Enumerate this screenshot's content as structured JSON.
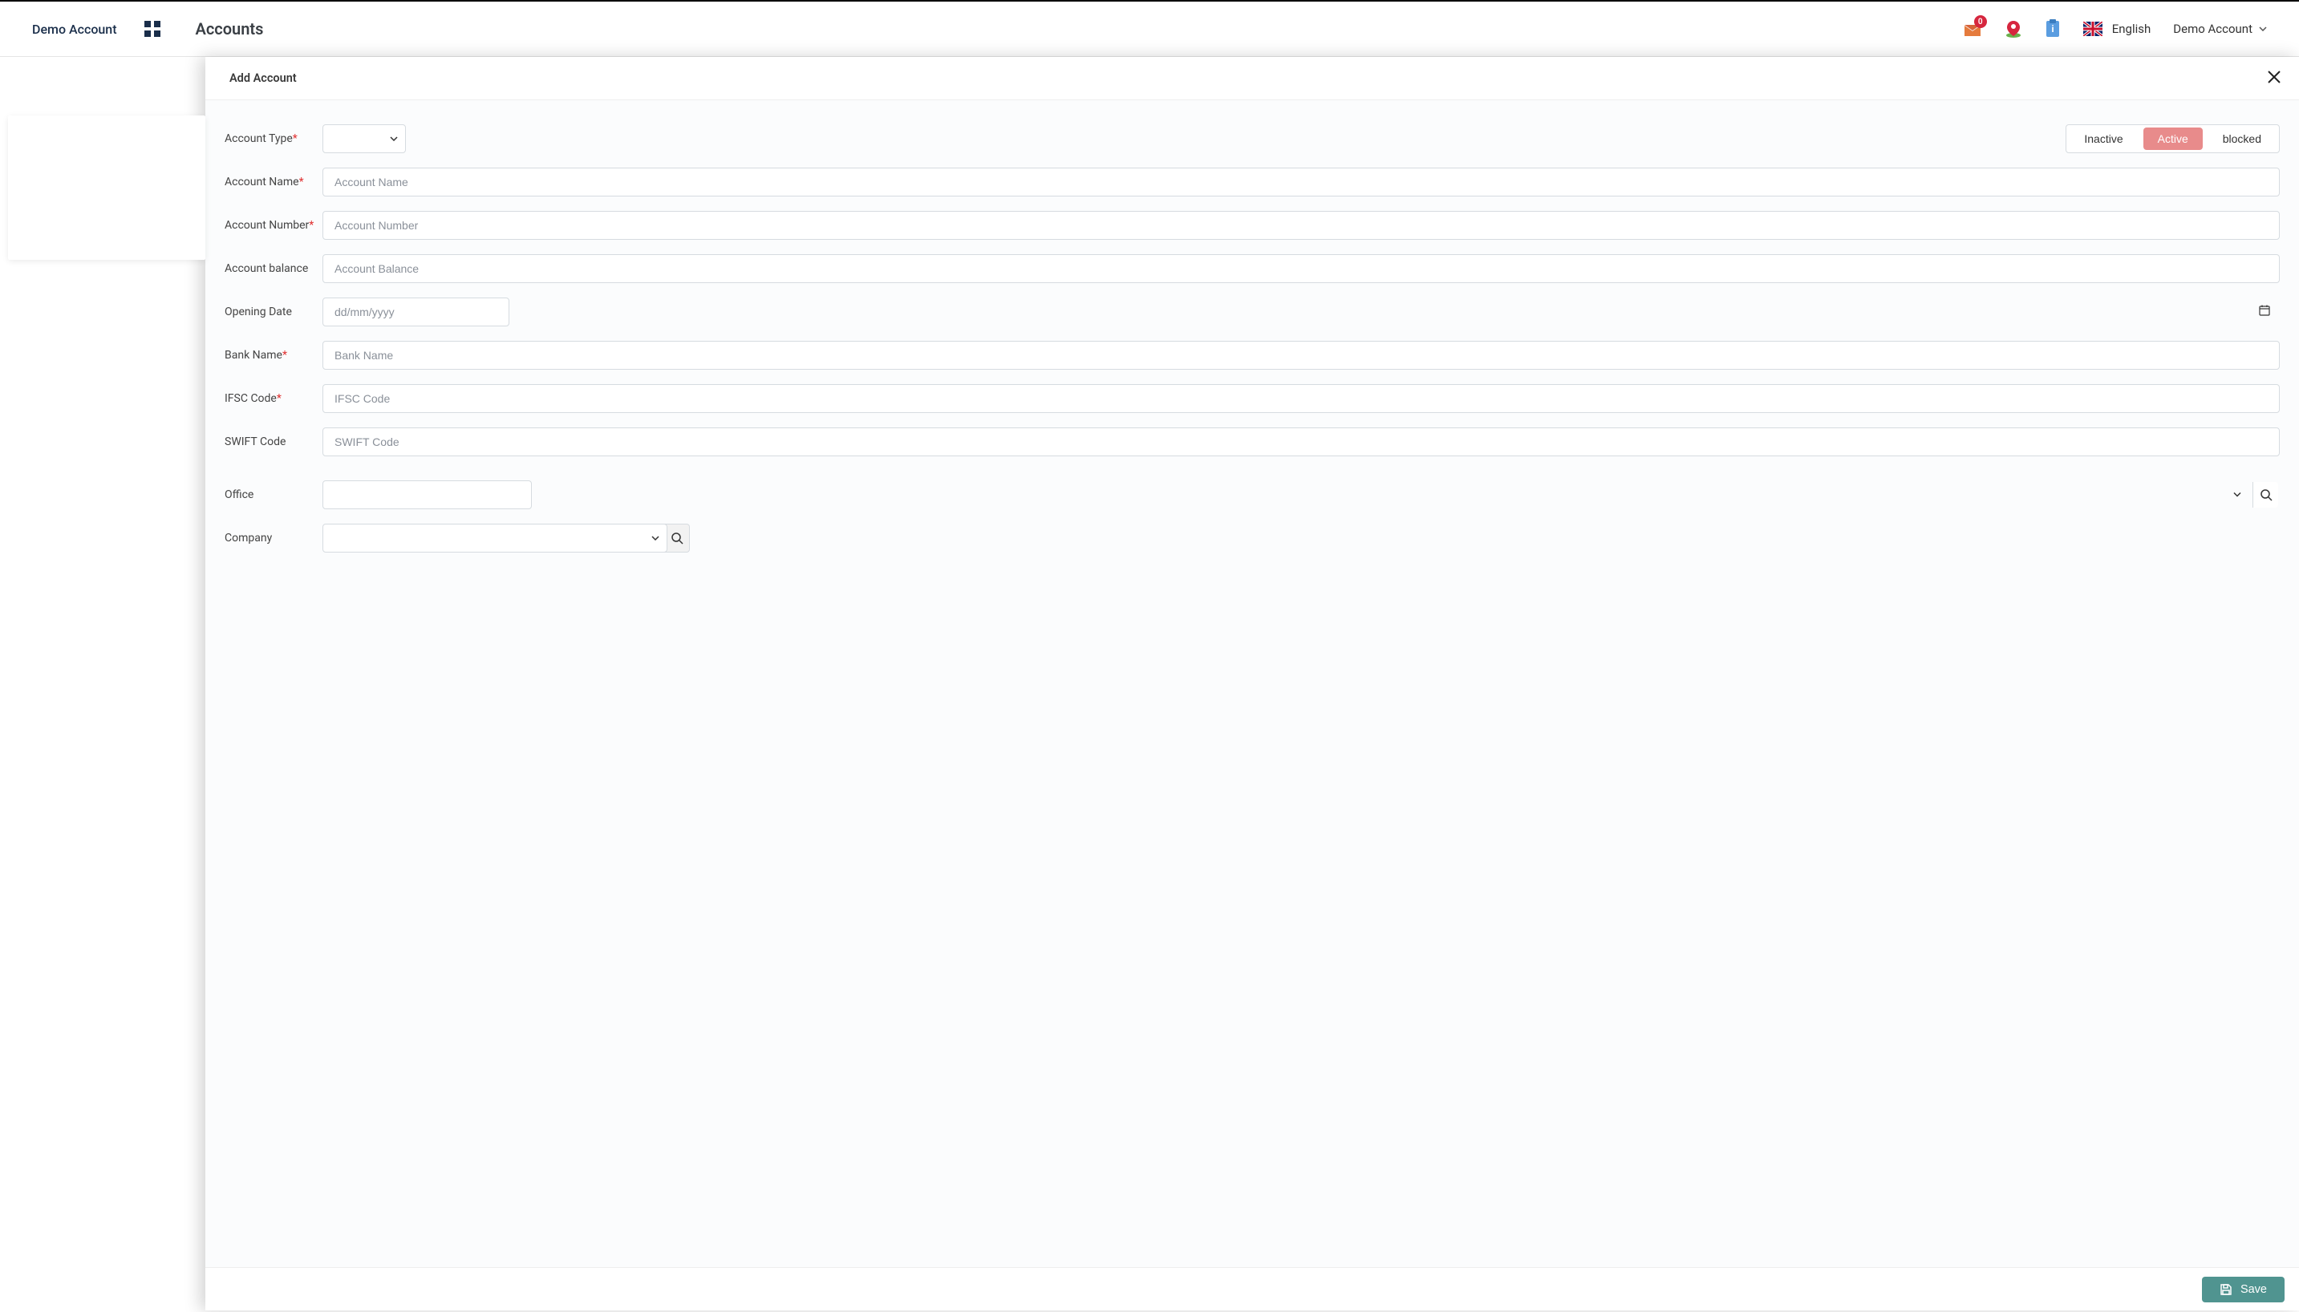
{
  "header": {
    "brand": "Demo Account",
    "page_title": "Accounts",
    "mail_badge": "0",
    "language": "English",
    "user_label": "Demo Account"
  },
  "panel": {
    "title": "Add Account"
  },
  "status": {
    "inactive": "Inactive",
    "active": "Active",
    "blocked": "blocked"
  },
  "form": {
    "account_type_label": "Account Type",
    "account_name_label": "Account Name",
    "account_name_placeholder": "Account Name",
    "account_number_label": "Account Number",
    "account_number_placeholder": "Account Number",
    "account_balance_label": "Account balance",
    "account_balance_placeholder": "Account Balance",
    "opening_date_label": "Opening Date",
    "opening_date_placeholder": "dd/mm/yyyy",
    "bank_name_label": "Bank Name",
    "bank_name_placeholder": "Bank Name",
    "ifsc_label": "IFSC Code",
    "ifsc_placeholder": "IFSC Code",
    "swift_label": "SWIFT Code",
    "swift_placeholder": "SWIFT Code",
    "office_label": "Office",
    "company_label": "Company"
  },
  "footer": {
    "save": "Save"
  }
}
